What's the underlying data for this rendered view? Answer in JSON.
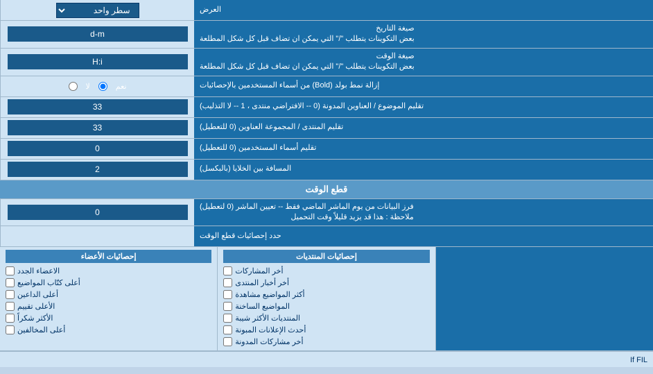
{
  "header": {
    "title": "العرض",
    "dropdown_label": "سطر واحد"
  },
  "rows": [
    {
      "label": "صيغة التاريخ\nبعض التكوينات يتطلب \"/\" التي يمكن ان تضاف قبل كل شكل المطلعة",
      "value": "d-m",
      "type": "input"
    },
    {
      "label": "صيغة الوقت\nبعض التكوينات يتطلب \"/\" التي يمكن ان تضاف قبل كل شكل المطلعة",
      "value": "H:i",
      "type": "input"
    },
    {
      "label": "إزالة نمط بولد (Bold) من أسماء المستخدمين بالإحصائيات",
      "type": "radio",
      "options": [
        "نعم",
        "لا"
      ],
      "selected": "نعم"
    },
    {
      "label": "تقليم الموضوع / العناوين المدونة (0 -- الافتراضي منتدى ، 1 -- لا التذليب)",
      "value": "33",
      "type": "input"
    },
    {
      "label": "تقليم المنتدى / المجموعة العناوين (0 للتعطيل)",
      "value": "33",
      "type": "input"
    },
    {
      "label": "تقليم أسماء المستخدمين (0 للتعطيل)",
      "value": "0",
      "type": "input"
    },
    {
      "label": "المسافة بين الخلايا (بالبكسل)",
      "value": "2",
      "type": "input"
    }
  ],
  "time_cut_section": {
    "title": "قطع الوقت",
    "row": {
      "label": "فرز البيانات من يوم الماشر الماضي فقط -- تعيين الماشر (0 لتعطيل)\nملاحظة : هذا قد يزيد قليلاً وقت التحميل",
      "value": "0"
    },
    "stats_label": "حدد إحصائيات قطع الوقت"
  },
  "stats": {
    "posts_col_title": "إحصائيات المنتديات",
    "members_col_title": "إحصائيات الأعضاء",
    "posts_items": [
      "أخر المشاركات",
      "أخر أخبار المنتدى",
      "أكثر المواضيع مشاهدة",
      "المواضيع الساخنة",
      "المنتديات الأكثر شيبة",
      "أحدث الإعلانات المبونة",
      "أخر مشاركات المدونة"
    ],
    "members_items": [
      "الاعضاء الجدد",
      "أعلى كتّاب المواضيع",
      "أعلى الداعين",
      "الأعلى تقييم",
      "الأكثر شكراً",
      "أعلى المخالفين"
    ],
    "if_fil_label": "If FIL"
  }
}
